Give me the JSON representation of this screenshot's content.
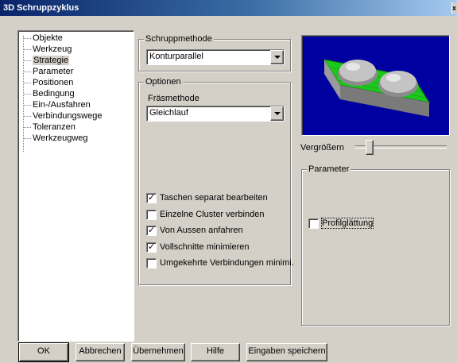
{
  "window": {
    "title": "3D Schruppzyklus",
    "close_glyph": "x"
  },
  "tree": {
    "items": [
      {
        "label": "Objekte",
        "selected": false
      },
      {
        "label": "Werkzeug",
        "selected": false
      },
      {
        "label": "Strategie",
        "selected": true
      },
      {
        "label": "Parameter",
        "selected": false
      },
      {
        "label": "Positionen",
        "selected": false
      },
      {
        "label": "Bedingung",
        "selected": false
      },
      {
        "label": "Ein-/Ausfahren",
        "selected": false
      },
      {
        "label": "Verbindungswege",
        "selected": false
      },
      {
        "label": "Toleranzen",
        "selected": false
      },
      {
        "label": "Werkzeugweg",
        "selected": false
      }
    ]
  },
  "schruppmethode": {
    "legend": "Schruppmethode",
    "value": "Konturparallel"
  },
  "optionen": {
    "legend": "Optionen",
    "fraesmethode_label": "Fräsmethode",
    "fraesmethode_value": "Gleichlauf",
    "checks": [
      {
        "label": "Taschen separat bearbeiten",
        "checked": true
      },
      {
        "label": "Einzelne Cluster verbinden",
        "checked": false
      },
      {
        "label": "Von Aussen anfahren",
        "checked": true
      },
      {
        "label": "Vollschnitte minimieren",
        "checked": true
      },
      {
        "label": "Umgekehrte Verbindungen minimi.",
        "checked": false
      }
    ]
  },
  "zoom": {
    "label": "Vergrößern",
    "level": 0.12
  },
  "parameter": {
    "legend": "Parameter",
    "profil_label": "Profilglättung",
    "profil_checked": false
  },
  "buttons": {
    "ok": "OK",
    "abbrechen": "Abbrechen",
    "uebernehmen": "Übernehmen",
    "hilfe": "Hilfe",
    "speichern": "Eingaben speichern"
  },
  "colors": {
    "preview_bg": "#0000a0",
    "block": "#1cc81c",
    "dome": "#b8b8b8"
  }
}
